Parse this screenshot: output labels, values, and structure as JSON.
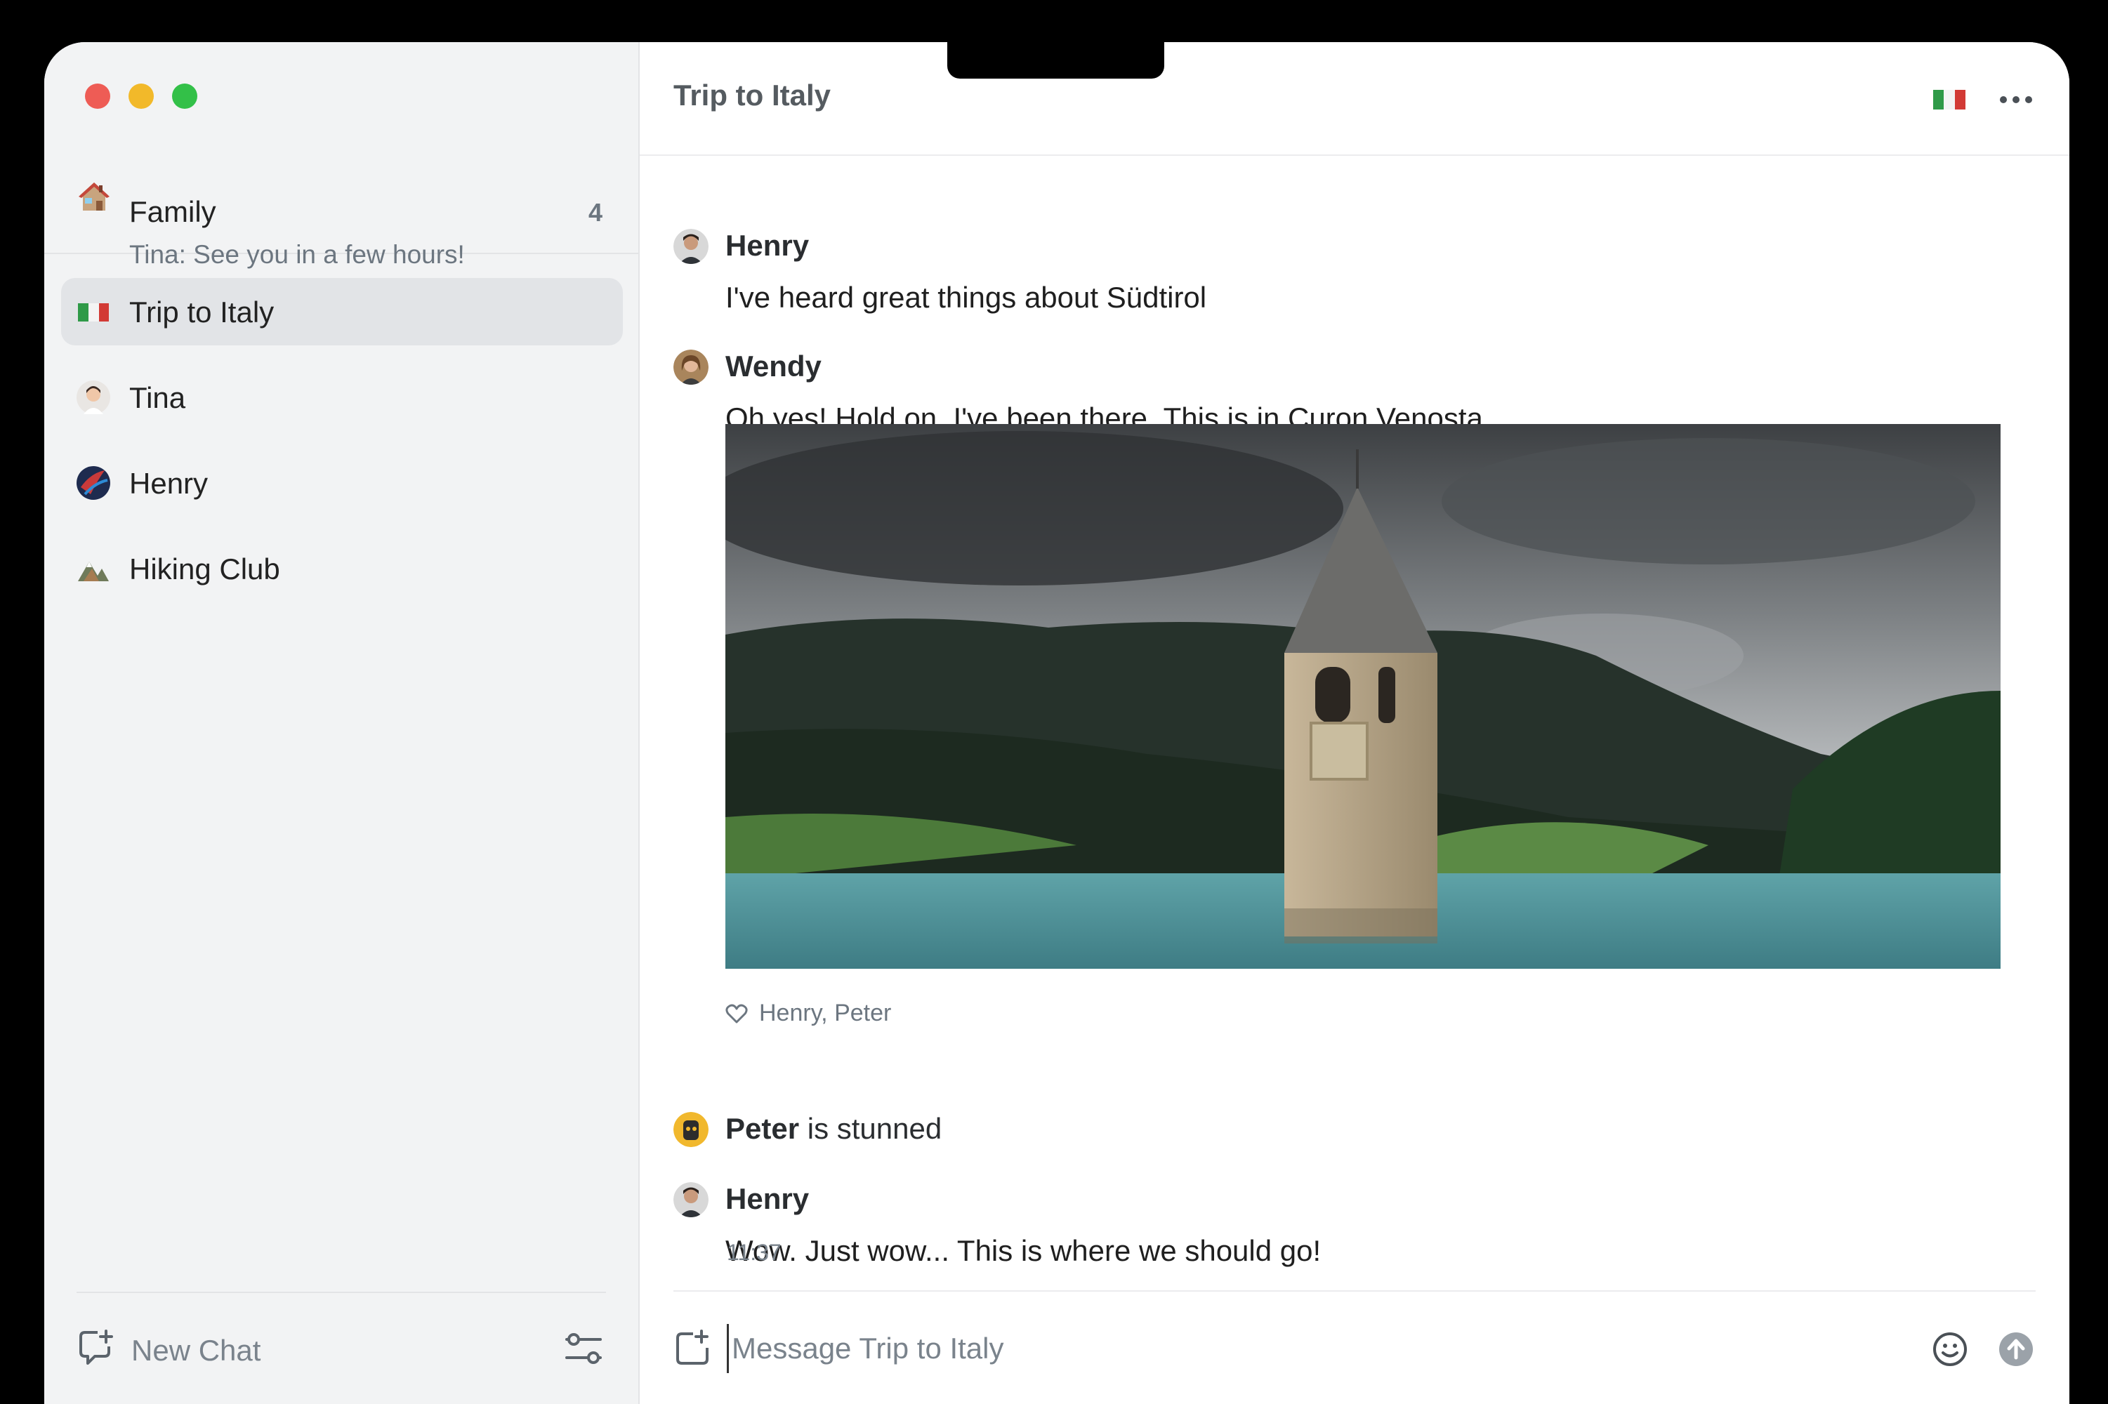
{
  "sidebar": {
    "family": {
      "icon": "house-emoji-icon",
      "name": "Family",
      "count": "4",
      "preview": "Tina: See you in a few hours!"
    },
    "chats": [
      {
        "icon": "italy-flag-icon",
        "label": "Trip to Italy",
        "active": true
      },
      {
        "icon": "tina-avatar",
        "label": "Tina",
        "active": false
      },
      {
        "icon": "henry-avatar",
        "label": "Henry",
        "active": false
      },
      {
        "icon": "mountain-icon",
        "label": "Hiking Club",
        "active": false
      }
    ],
    "footer": {
      "new_chat_label": "New Chat",
      "new_chat_icon": "new-chat-icon",
      "filter_icon": "filter-icon"
    }
  },
  "header": {
    "title": "Trip to Italy",
    "flag_icon": "italy-flag-icon",
    "more_icon": "more-icon"
  },
  "messages": [
    {
      "sender": "Henry",
      "text": "I've heard great things about Südtirol"
    },
    {
      "sender": "Wendy",
      "text": "Oh yes! Hold on, I've been there. This is in Curon Venosta."
    },
    {
      "sender": "Peter",
      "status": "is stunned"
    },
    {
      "sender": "Henry",
      "text": "Wow. Just wow... This is where we should go!",
      "time": "11:37"
    }
  ],
  "photo": {
    "reaction_icon": "heart-icon",
    "reaction_names": "Henry, Peter"
  },
  "composer": {
    "placeholder": "Message Trip to Italy",
    "attach_icon": "attach-icon",
    "emoji_icon": "emoji-icon",
    "send_icon": "send-icon"
  },
  "colors": {
    "sidebar_bg": "#f2f3f4",
    "active_item_bg": "#e2e4e7",
    "muted_text": "#6c7680",
    "traffic_red": "#ee5c55",
    "traffic_yellow": "#f2b92a",
    "traffic_green": "#33c048"
  }
}
